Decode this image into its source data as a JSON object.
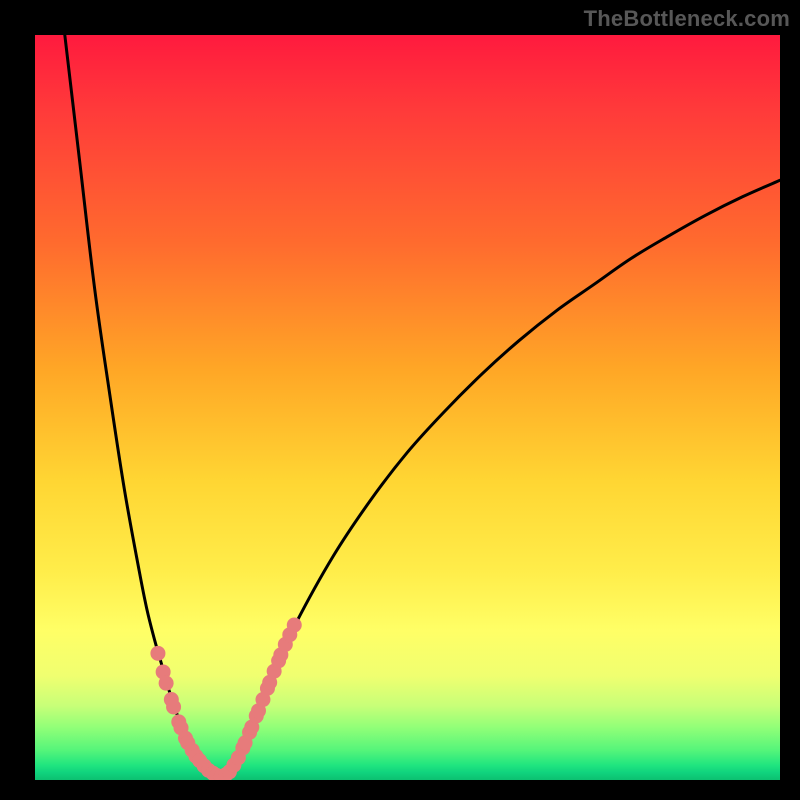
{
  "watermark": "TheBottleneck.com",
  "chart_data": {
    "type": "line",
    "title": "",
    "xlabel": "",
    "ylabel": "",
    "xlim": [
      0,
      100
    ],
    "ylim": [
      0,
      100
    ],
    "gradient_stops": [
      {
        "pos": 0,
        "color": "#ff1a3e"
      },
      {
        "pos": 10,
        "color": "#ff3a3a"
      },
      {
        "pos": 28,
        "color": "#ff6b2e"
      },
      {
        "pos": 45,
        "color": "#ffa726"
      },
      {
        "pos": 60,
        "color": "#ffd633"
      },
      {
        "pos": 72,
        "color": "#ffed4a"
      },
      {
        "pos": 80,
        "color": "#ffff66"
      },
      {
        "pos": 86,
        "color": "#f0ff70"
      },
      {
        "pos": 90,
        "color": "#c8ff78"
      },
      {
        "pos": 93,
        "color": "#90ff78"
      },
      {
        "pos": 96,
        "color": "#55f57a"
      },
      {
        "pos": 98,
        "color": "#20e57f"
      },
      {
        "pos": 99,
        "color": "#10d37e"
      },
      {
        "pos": 100,
        "color": "#0cc070"
      }
    ],
    "series": [
      {
        "name": "left-branch",
        "x": [
          4,
          6,
          8,
          10,
          12,
          14,
          15,
          16,
          17,
          18,
          19,
          20,
          21,
          22,
          23,
          24
        ],
        "y": [
          100,
          83,
          66,
          52,
          39,
          28,
          23,
          19,
          15.5,
          12,
          9,
          6.5,
          4.5,
          3,
          1.5,
          0.5
        ]
      },
      {
        "name": "right-branch",
        "x": [
          25,
          26,
          27,
          28,
          29,
          30,
          32,
          35,
          40,
          45,
          50,
          55,
          60,
          65,
          70,
          75,
          80,
          85,
          90,
          95,
          100
        ],
        "y": [
          0.5,
          1.2,
          2.8,
          4.8,
          7.0,
          9.5,
          14.5,
          21,
          30,
          37.5,
          44,
          49.5,
          54.5,
          59,
          63,
          66.5,
          70,
          73,
          75.8,
          78.3,
          80.5
        ]
      }
    ],
    "markers": {
      "color": "#e77b7b",
      "points": [
        {
          "x": 16.5,
          "y": 17
        },
        {
          "x": 17.2,
          "y": 14.5
        },
        {
          "x": 17.6,
          "y": 13
        },
        {
          "x": 18.3,
          "y": 10.8
        },
        {
          "x": 18.6,
          "y": 9.8
        },
        {
          "x": 19.3,
          "y": 7.8
        },
        {
          "x": 19.6,
          "y": 7.0
        },
        {
          "x": 20.2,
          "y": 5.6
        },
        {
          "x": 20.5,
          "y": 5.0
        },
        {
          "x": 21.1,
          "y": 4.0
        },
        {
          "x": 21.6,
          "y": 3.2
        },
        {
          "x": 22.1,
          "y": 2.6
        },
        {
          "x": 22.7,
          "y": 1.9
        },
        {
          "x": 23.3,
          "y": 1.3
        },
        {
          "x": 23.9,
          "y": 0.9
        },
        {
          "x": 24.4,
          "y": 0.6
        },
        {
          "x": 25.0,
          "y": 0.45
        },
        {
          "x": 25.6,
          "y": 0.7
        },
        {
          "x": 26.1,
          "y": 1.1
        },
        {
          "x": 26.7,
          "y": 2.0
        },
        {
          "x": 27.3,
          "y": 3.0
        },
        {
          "x": 27.9,
          "y": 4.3
        },
        {
          "x": 28.2,
          "y": 5.0
        },
        {
          "x": 28.8,
          "y": 6.4
        },
        {
          "x": 29.1,
          "y": 7.1
        },
        {
          "x": 29.7,
          "y": 8.6
        },
        {
          "x": 30.0,
          "y": 9.3
        },
        {
          "x": 30.6,
          "y": 10.8
        },
        {
          "x": 31.2,
          "y": 12.3
        },
        {
          "x": 31.5,
          "y": 13.1
        },
        {
          "x": 32.1,
          "y": 14.6
        },
        {
          "x": 32.7,
          "y": 16.0
        },
        {
          "x": 33.0,
          "y": 16.8
        },
        {
          "x": 33.6,
          "y": 18.2
        },
        {
          "x": 34.2,
          "y": 19.5
        },
        {
          "x": 34.8,
          "y": 20.8
        }
      ]
    }
  }
}
